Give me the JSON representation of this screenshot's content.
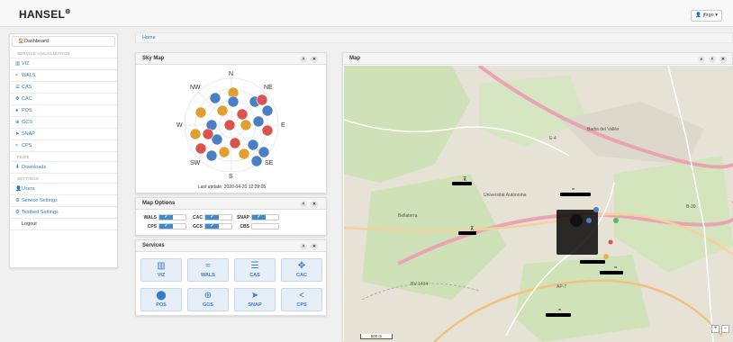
{
  "app": {
    "brand": "HANSEL",
    "brand_mark": "⚙",
    "user": "jfirgo"
  },
  "sidebar": {
    "items": [
      {
        "icon": "🏠",
        "label": "Dashboard"
      },
      {
        "head": "SERVICE VISUALIZATION"
      },
      {
        "icon": "▥",
        "label": "VIZ"
      },
      {
        "icon": "≈",
        "label": "WALS"
      },
      {
        "icon": "☰",
        "label": "CAS"
      },
      {
        "icon": "✥",
        "label": "CAC"
      },
      {
        "icon": "●",
        "label": "POS"
      },
      {
        "icon": "⊕",
        "label": "GCS"
      },
      {
        "icon": "➤",
        "label": "SNAP"
      },
      {
        "icon": "<",
        "label": "CPS"
      },
      {
        "head": "FILES"
      },
      {
        "icon": "⬇",
        "label": "Downloads"
      },
      {
        "head": "SETTINGS"
      },
      {
        "icon": "👤",
        "label": "Users"
      },
      {
        "icon": "⚙",
        "label": "Service Settings"
      },
      {
        "icon": "⚙",
        "label": "Testbed Settings"
      },
      {
        "icon": "",
        "label": "Logout"
      }
    ]
  },
  "breadcrumb": "Home",
  "skymap": {
    "title": "Sky Map",
    "dirs": {
      "n": "N",
      "ne": "NE",
      "e": "E",
      "se": "SE",
      "s": "S",
      "sw": "SW",
      "w": "W",
      "nw": "NW"
    },
    "last_update": "Last update: 2020-04-20 12:29:05",
    "colors": {
      "gps": "#4a7fc4",
      "galileo": "#e0a030",
      "glonass": "#d9534f"
    }
  },
  "options": {
    "title": "Map Options",
    "toggle_on": "✓",
    "items": [
      {
        "label": "WALS"
      },
      {
        "label": "CAC"
      },
      {
        "label": "SNAP"
      },
      {
        "label": "CPS"
      },
      {
        "label": "GCS"
      },
      {
        "label": "CBS"
      }
    ]
  },
  "services": {
    "title": "Services",
    "buttons": [
      {
        "icon": "▥",
        "label": "VIZ"
      },
      {
        "icon": "≈",
        "label": "WALS"
      },
      {
        "icon": "☰",
        "label": "CAS"
      },
      {
        "icon": "✥",
        "label": "CAC"
      },
      {
        "icon": "⬤",
        "label": "POS"
      },
      {
        "icon": "⊕",
        "label": "GCS"
      },
      {
        "icon": "➤",
        "label": "SNAP"
      },
      {
        "icon": "<",
        "label": "CPS"
      }
    ]
  },
  "map": {
    "title": "Map",
    "places": {
      "badia": "Badia del Vallès",
      "univ": "Universitat Autònoma",
      "bellaterra": "Bellaterra",
      "e4": "E-4",
      "bv1414": "BV-1414",
      "ap7": "AP-7",
      "b30": "B-30"
    },
    "scale": "500 m"
  }
}
